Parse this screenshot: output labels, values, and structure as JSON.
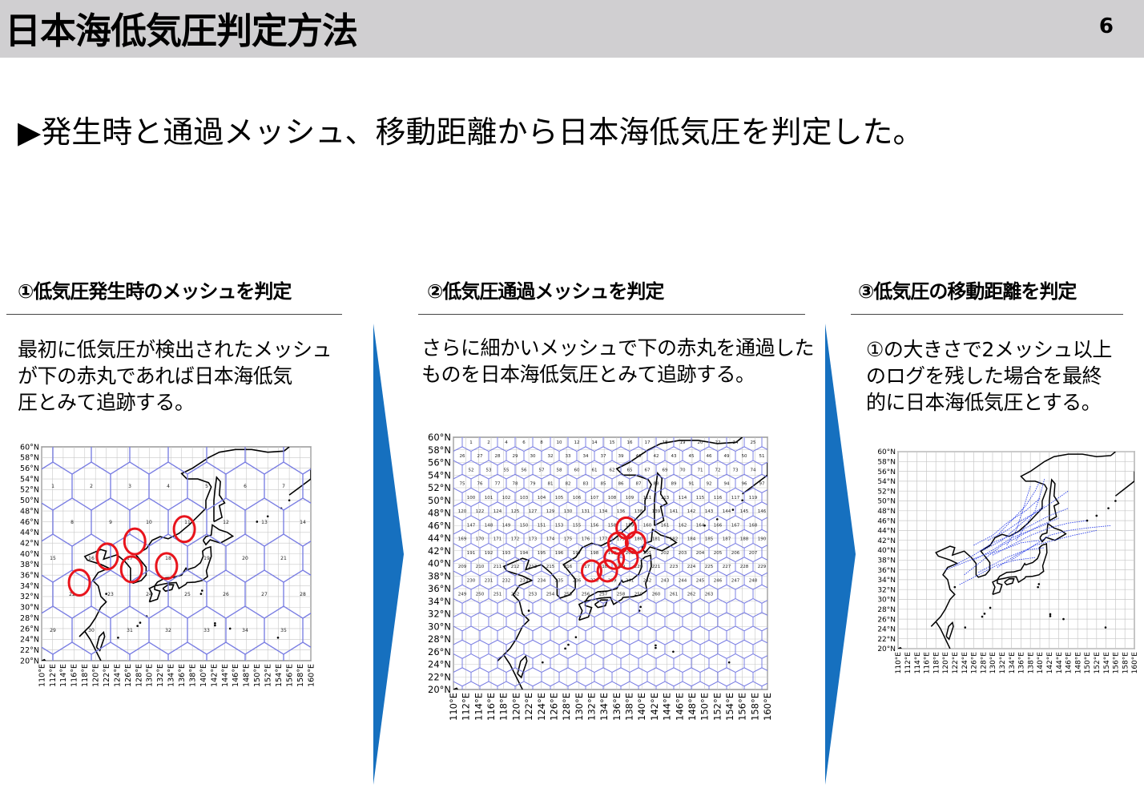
{
  "header": {
    "title": "日本海低気圧判定方法",
    "page_number": "6"
  },
  "lead": "▶発生時と通過メッシュ、移動距離から日本海低気圧を判定した。",
  "steps": [
    {
      "heading": "①低気圧発生時のメッシュを判定",
      "lines": [
        "最初に低気圧が検出されたメッシュ",
        "が下の赤丸であれば日本海低気",
        "圧とみて追跡する。"
      ]
    },
    {
      "heading": "②低気圧通過メッシュを判定",
      "lines": [
        "さらに細かいメッシュで下の赤丸を通過した",
        "ものを日本海低気圧とみて追跡する。"
      ]
    },
    {
      "heading": "③低気圧の移動距離を判定",
      "lines": [
        "①の大きさで2メッシュ以上",
        "のログを残した場合を最終",
        "的に日本海低気圧とする。"
      ]
    }
  ],
  "maps": {
    "lat_labels": [
      "60°N",
      "58°N",
      "56°N",
      "54°N",
      "52°N",
      "50°N",
      "48°N",
      "46°N",
      "44°N",
      "42°N",
      "40°N",
      "38°N",
      "36°N",
      "34°N",
      "32°N",
      "30°N",
      "28°N",
      "26°N",
      "24°N",
      "22°N",
      "20°N"
    ],
    "lon_labels": [
      "110°E",
      "112°E",
      "114°E",
      "116°E",
      "118°E",
      "120°E",
      "122°E",
      "124°E",
      "126°E",
      "128°E",
      "130°E",
      "132°E",
      "134°E",
      "136°E",
      "138°E",
      "140°E",
      "142°E",
      "144°E",
      "146°E",
      "148°E",
      "150°E",
      "152°E",
      "154°E",
      "156°E",
      "158°E",
      "160°E"
    ],
    "map1_cell_ids": [
      "1",
      "2",
      "3",
      "4",
      "5",
      "6",
      "7",
      "8",
      "9",
      "10",
      "11",
      "12",
      "13",
      "14",
      "15",
      "16",
      "17",
      "18",
      "19",
      "20",
      "21",
      "22",
      "23",
      "24",
      "25",
      "26",
      "27",
      "28",
      "29",
      "30",
      "31",
      "32",
      "33",
      "34",
      "35",
      "36",
      "37",
      "38",
      "39",
      "40",
      "41",
      "42"
    ],
    "map2_cell_ids": [
      "1",
      "2",
      "4",
      "6",
      "8",
      "10",
      "12",
      "14",
      "15",
      "16",
      "17",
      "18",
      "19",
      "20",
      "22",
      "24",
      "25",
      "26",
      "27",
      "28",
      "29",
      "30",
      "32",
      "33",
      "34",
      "37",
      "39",
      "40",
      "42",
      "43",
      "45",
      "46",
      "49",
      "50",
      "51",
      "52",
      "53",
      "55",
      "56",
      "57",
      "58",
      "60",
      "61",
      "62",
      "65",
      "67",
      "69",
      "70",
      "71",
      "72",
      "73",
      "74",
      "75",
      "76",
      "77",
      "78",
      "79",
      "81",
      "82",
      "83",
      "85",
      "86",
      "87",
      "88",
      "89",
      "91",
      "92",
      "94",
      "96",
      "97",
      "100",
      "101",
      "102",
      "103",
      "104",
      "105",
      "106",
      "107",
      "108",
      "109",
      "111",
      "113",
      "114",
      "115",
      "116",
      "117",
      "119",
      "120",
      "122",
      "124",
      "125",
      "127",
      "129",
      "130",
      "131",
      "134",
      "136",
      "138",
      "139",
      "141",
      "142",
      "143",
      "144",
      "145",
      "146",
      "147",
      "148",
      "149",
      "150",
      "151",
      "153",
      "155",
      "156",
      "158",
      "159",
      "160",
      "161",
      "162",
      "164",
      "166",
      "167",
      "168",
      "169",
      "170",
      "171",
      "172",
      "173",
      "174",
      "175",
      "176",
      "177",
      "179",
      "180",
      "181",
      "182",
      "184",
      "185",
      "187",
      "188",
      "190",
      "191",
      "192",
      "193",
      "194",
      "195",
      "196",
      "197",
      "198",
      "199",
      "200",
      "201",
      "202",
      "203",
      "204",
      "205",
      "206",
      "207",
      "209",
      "210",
      "211",
      "212",
      "213",
      "215",
      "216",
      "217",
      "218",
      "219",
      "220",
      "221",
      "223",
      "224",
      "225",
      "227",
      "228",
      "229",
      "230",
      "231",
      "232",
      "233",
      "234",
      "235",
      "236",
      "238",
      "239",
      "241",
      "242",
      "243",
      "244",
      "245",
      "246",
      "247",
      "248",
      "249",
      "250",
      "251",
      "252",
      "253",
      "254",
      "255",
      "256",
      "257",
      "258",
      "259",
      "260",
      "261",
      "262",
      "263"
    ]
  },
  "colors": {
    "header_bg": "#d0cfd1",
    "mesh": "#7b7fe3",
    "highlight": "#e8141c",
    "arrow": "#1670bf",
    "track": "#2a3ee8"
  }
}
